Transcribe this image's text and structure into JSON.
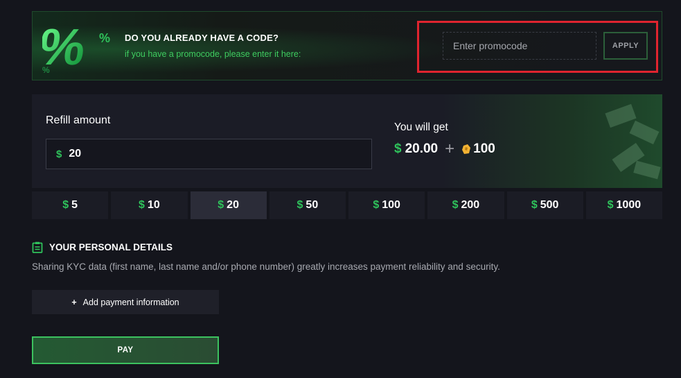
{
  "promo": {
    "title": "DO YOU ALREADY HAVE A CODE?",
    "subtitle": "if you have a promocode, please enter it here:",
    "input_placeholder": "Enter promocode",
    "input_value": "",
    "apply_label": "APPLY",
    "art_icon": "percent-icon"
  },
  "refill": {
    "label": "Refill amount",
    "currency_symbol": "$",
    "amount": "20",
    "get_label": "You will get",
    "get_amount": "20.00",
    "bonus_icon": "coin-icon",
    "bonus_amount": "100"
  },
  "presets": {
    "currency_symbol": "$",
    "selected": "20",
    "options": [
      "5",
      "10",
      "20",
      "50",
      "100",
      "200",
      "500",
      "1000"
    ]
  },
  "details": {
    "icon": "clipboard-icon",
    "heading": "YOUR PERSONAL DETAILS",
    "description": "Sharing KYC data (first name, last name and/or phone number) greatly increases payment reliability and security.",
    "add_label": "Add payment information",
    "add_symbol": "+"
  },
  "pay": {
    "label": "PAY"
  },
  "colors": {
    "background": "#14151c",
    "accent_green": "#2fc25b",
    "highlight_red": "#e0242f",
    "coin_gold": "#f2b233"
  }
}
